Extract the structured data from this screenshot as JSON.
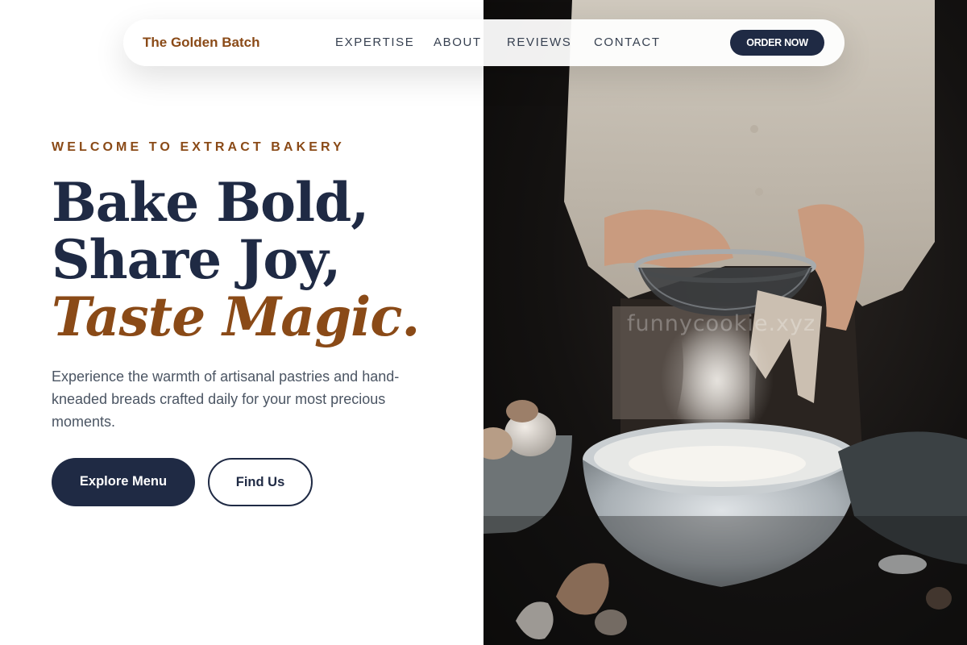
{
  "nav": {
    "brand": "The Golden Batch",
    "links": [
      "EXPERTISE",
      "ABOUT",
      "REVIEWS",
      "CONTACT"
    ],
    "cta": "ORDER NOW"
  },
  "hero": {
    "eyebrow": "WELCOME TO EXTRACT BAKERY",
    "headline_line1": "Bake Bold,",
    "headline_line2": "Share Joy,",
    "headline_line3": "Taste Magic.",
    "description": "Experience the warmth of artisanal pastries and hand-kneaded breads crafted daily for your most precious moments.",
    "primary_button": "Explore Menu",
    "secondary_button": "Find Us"
  },
  "image": {
    "watermark": "funnycookie.xyz"
  },
  "colors": {
    "accent": "#8a4a17",
    "navy": "#1f2a44",
    "body_text": "#4b5563"
  }
}
